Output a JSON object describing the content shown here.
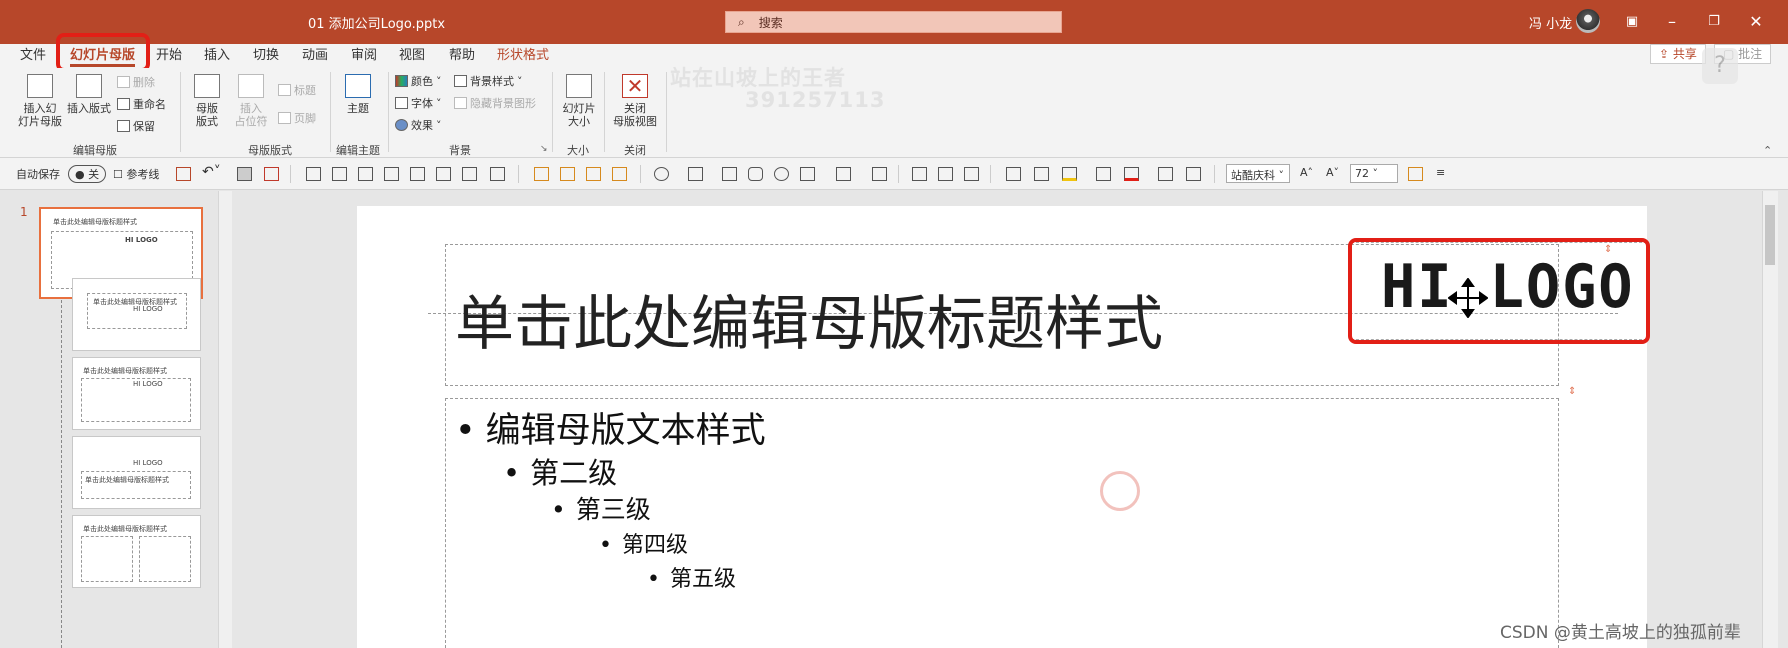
{
  "titlebar": {
    "filename": "01 添加公司Logo.pptx",
    "search_placeholder": "搜索",
    "user_name": "冯 小龙",
    "ribbon_display_icon": "ribbon-display-icon",
    "minimize": "–",
    "restore": "❐",
    "close": "✕"
  },
  "menu": {
    "tabs": [
      "文件",
      "幻灯片母版",
      "开始",
      "插入",
      "切换",
      "动画",
      "审阅",
      "视图",
      "帮助",
      "形状格式"
    ],
    "share": "共享",
    "comment": "批注"
  },
  "ribbon": {
    "edit_master": {
      "insert_slide_master": "插入幻\n灯片母版",
      "insert_layout": "插入版式",
      "delete": "删除",
      "rename": "重命名",
      "preserve": "保留",
      "label": "编辑母版"
    },
    "master_layout": {
      "master_layout": "母版\n版式",
      "insert_placeholder": "插入\n占位符",
      "title": "标题",
      "footer": "页脚",
      "label": "母版版式"
    },
    "edit_theme": {
      "themes": "主题",
      "label": "编辑主题"
    },
    "background": {
      "colors": "颜色",
      "fonts": "字体",
      "effects": "效果",
      "background_styles": "背景样式",
      "hide_background": "隐藏背景图形",
      "label": "背景"
    },
    "size": {
      "slide_size": "幻灯片\n大小",
      "label": "大小"
    },
    "close": {
      "close_master_view": "关闭\n母版视图",
      "label": "关闭"
    }
  },
  "watermark": {
    "line1": "站在山坡上的王者",
    "line2": "391257113"
  },
  "qat": {
    "autosave_label": "自动保存",
    "autosave_state": "关",
    "gridlines_label": "参考线",
    "font_name": "站酷庆科",
    "font_size": "72"
  },
  "thumbnails": {
    "slide_number": "1",
    "items": [
      {
        "title": "单击此处编辑母版标题样式",
        "logo": "HI LOGO"
      },
      {
        "title": "单击此处编辑母版标题样式",
        "logo": "HI LOGO"
      },
      {
        "title": "单击此处编辑母版标题样式",
        "logo": "HI LOGO"
      },
      {
        "title": "单击此处编辑母版标题样式",
        "logo": "HI LOGO"
      },
      {
        "title": "单击此处编辑母版标题样式",
        "logo": ""
      }
    ]
  },
  "slide": {
    "title": "单击此处编辑母版标题样式",
    "logo": "HI LOGO",
    "bullets": [
      {
        "text": "编辑母版文本样式"
      },
      {
        "text": "第二级"
      },
      {
        "text": "第三级"
      },
      {
        "text": "第四级"
      },
      {
        "text": "第五级"
      }
    ]
  },
  "footer_watermark": "CSDN @黄土高坡上的独孤前辈",
  "colors": {
    "accent": "#b7472a",
    "highlight_box": "#e21f16",
    "thumb_selected": "#e8703e"
  }
}
